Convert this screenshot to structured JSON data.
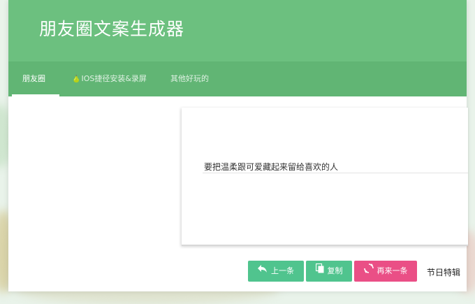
{
  "app": {
    "title": "朋友圈文案生成器"
  },
  "tabs": [
    {
      "label": "朋友圈",
      "emoji": ""
    },
    {
      "label": "IOS捷径安装&录屏",
      "emoji": "🍐"
    },
    {
      "label": "其他好玩的",
      "emoji": ""
    }
  ],
  "active_tab": "朋友圈",
  "card": {
    "text": "要把温柔跟可爱藏起来留给喜欢的人"
  },
  "buttons": {
    "prev_label": "上一条",
    "copy_label": "复制",
    "next_label": "再来一条",
    "festival_label": "节日特辑"
  },
  "colors": {
    "header": "#6cc07f",
    "tabbar": "#61b574",
    "button_green": "#50c48e",
    "button_pink": "#ea4f86"
  },
  "icons": {
    "prev": "reply-arrow-icon",
    "copy": "copy-icon",
    "next": "refresh-icon"
  }
}
